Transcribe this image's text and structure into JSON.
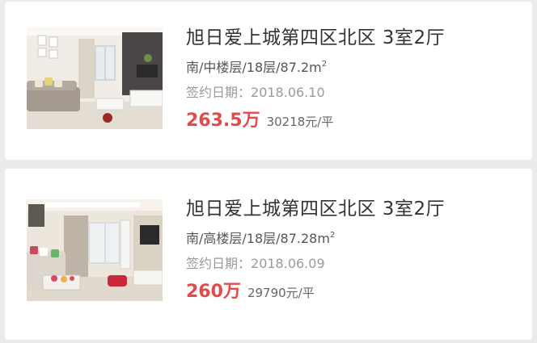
{
  "listings": [
    {
      "title": "旭日爱上城第四区北区 3室2厅",
      "attributes": "南/中楼层/18层/87.2",
      "area_unit_base": "m",
      "area_unit_sup": "2",
      "sign_label": "签约日期：",
      "sign_date": "2018.06.10",
      "price": "263.5万",
      "unit_price": "30218元/平",
      "thumbnail": "living-room-photo"
    },
    {
      "title": "旭日爱上城第四区北区 3室2厅",
      "attributes": "南/高楼层/18层/87.28",
      "area_unit_base": "m",
      "area_unit_sup": "2",
      "sign_label": "签约日期：",
      "sign_date": "2018.06.09",
      "price": "260万",
      "unit_price": "29790元/平",
      "thumbnail": "living-room-photo"
    }
  ],
  "colors": {
    "price": "#e24b4b",
    "title": "#333333",
    "background": "#ebebed",
    "card": "#ffffff"
  }
}
